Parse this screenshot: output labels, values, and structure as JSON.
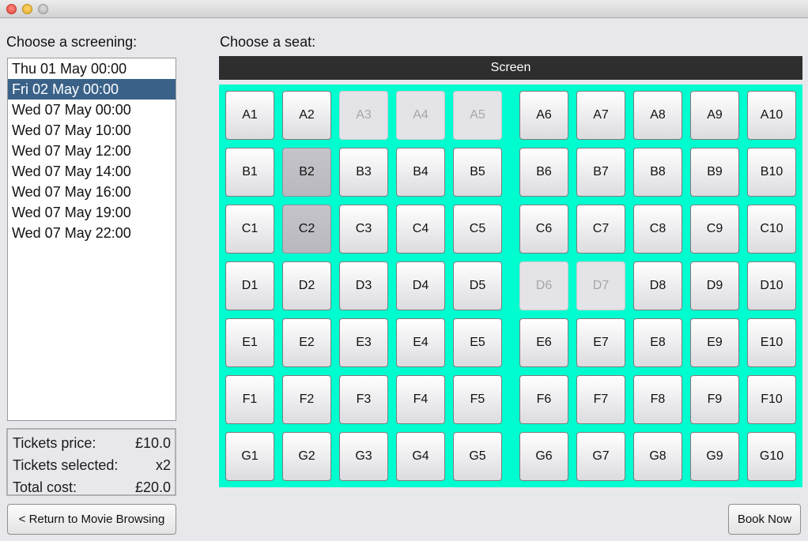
{
  "labels": {
    "choose_screening": "Choose a screening:",
    "choose_seat": "Choose a seat:",
    "screen": "Screen"
  },
  "screenings": {
    "selected_index": 1,
    "items": [
      "Thu 01 May 00:00",
      "Fri 02 May 00:00",
      "Wed 07 May 00:00",
      "Wed 07 May 10:00",
      "Wed 07 May 12:00",
      "Wed 07 May 14:00",
      "Wed 07 May 16:00",
      "Wed 07 May 19:00",
      "Wed 07 May 22:00"
    ]
  },
  "summary": {
    "price_label": "Tickets price:",
    "price_value": "£10.0",
    "selected_label": "Tickets selected:",
    "selected_value": "x2",
    "total_label": "Total cost:",
    "total_value": "£20.0"
  },
  "buttons": {
    "return_label": "< Return to Movie Browsing",
    "book_label": "Book Now"
  },
  "seats": {
    "rows": [
      "A",
      "B",
      "C",
      "D",
      "E",
      "F",
      "G"
    ],
    "columns": 10,
    "unavailable": [
      "A3",
      "A4",
      "A5",
      "D6",
      "D7"
    ],
    "selected": [
      "B2",
      "C2"
    ]
  },
  "colors": {
    "seat_area": "#00fdd0",
    "screen_bar": "#2e2e2e",
    "list_selection": "#3a6289"
  }
}
